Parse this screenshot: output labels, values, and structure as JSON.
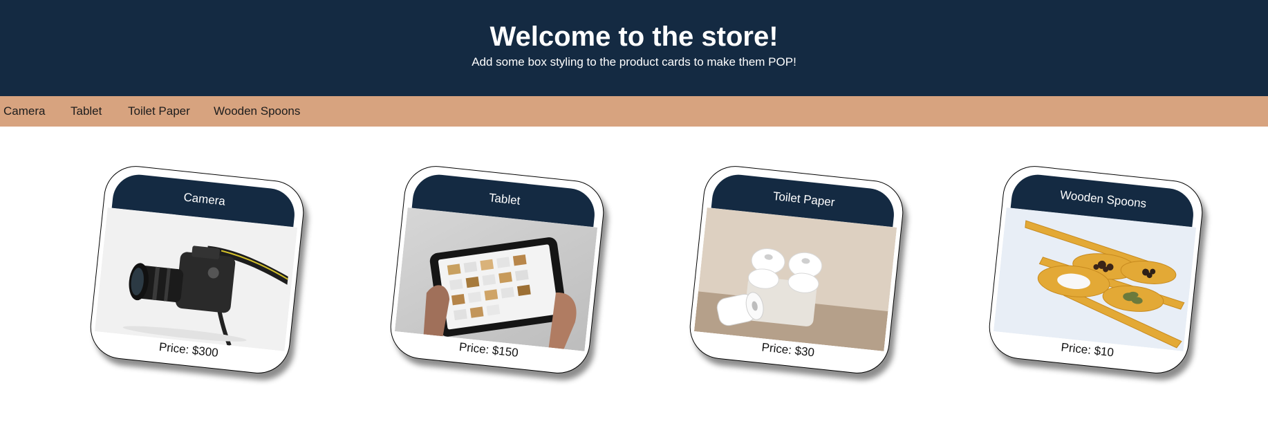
{
  "header": {
    "title": "Welcome to the store!",
    "subtitle": "Add some box styling to the product cards to make them POP!"
  },
  "nav": {
    "items": [
      "Camera",
      "Tablet",
      "Toilet Paper",
      "Wooden Spoons"
    ]
  },
  "products": [
    {
      "name": "Camera",
      "price": "Price: $300",
      "image": "camera-photo"
    },
    {
      "name": "Tablet",
      "price": "Price: $150",
      "image": "tablet-photo"
    },
    {
      "name": "Toilet Paper",
      "price": "Price: $30",
      "image": "toilet-paper-photo"
    },
    {
      "name": "Wooden Spoons",
      "price": "Price: $10",
      "image": "wooden-spoons-photo"
    }
  ],
  "colors": {
    "header_bg": "#142a42",
    "nav_bg": "#d7a37f",
    "card_title_bg": "#142a42"
  }
}
